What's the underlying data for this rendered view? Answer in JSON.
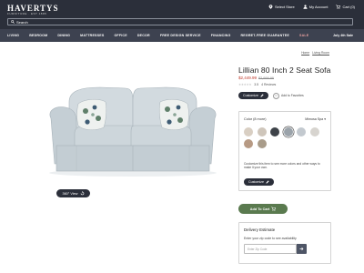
{
  "header": {
    "logo": "HAVERTYS",
    "tagline": "FURNITURE · EST 1885",
    "links": [
      {
        "label": "Select Store",
        "icon": "location-pin-icon"
      },
      {
        "label": "My Account",
        "icon": "user-icon"
      },
      {
        "label": "Cart (0)",
        "icon": "cart-icon"
      }
    ],
    "search_placeholder": "Search"
  },
  "nav": {
    "items": [
      "LIVING",
      "BEDROOM",
      "DINING",
      "MATTRESSES",
      "OFFICE",
      "DECOR",
      "FREE DESIGN SERVICE",
      "FINANCING",
      "REGRET-FREE GUARANTEE",
      "SALE"
    ],
    "promo": "July 4th Sale"
  },
  "breadcrumb": [
    "Home",
    "Living Room"
  ],
  "viewer": {
    "view360_label": "360° View"
  },
  "product": {
    "title": "Lillian 80 Inch 2 Seat Sofa",
    "sale_price": "$2,449.99",
    "original_price": "$2,999.99",
    "stars": "★★★★★",
    "rating": "3.5",
    "reviews": "4 Reviews",
    "customize_label": "Customize",
    "favorite_label": "Add to Favorites"
  },
  "colors": {
    "label": "Color (8 more)",
    "selected": "Mimosa Spa",
    "swatches": [
      "#d9cfc3",
      "#cfc6bb",
      "#3e4349",
      "#9ba3aa",
      "#c3c9cf",
      "#d7d4cf",
      "#b79a84",
      "#a99c8a"
    ],
    "selected_index": 3,
    "custom_text": "Customize this item to see more colors and other ways to make it your own.",
    "customize_label": "Customize"
  },
  "cart": {
    "add_label": "Add To Cart"
  },
  "delivery": {
    "title": "Delivery Estimate",
    "subtitle": "Enter your zip code to see availability",
    "zip_placeholder": "Enter Zip Code"
  },
  "colors_theme": {
    "header": "#2b2f3a",
    "nav": "#3d4250",
    "sale_price": "#c0392b",
    "cart_button": "#5a7a4f",
    "sofa": "#c9d3d8"
  }
}
